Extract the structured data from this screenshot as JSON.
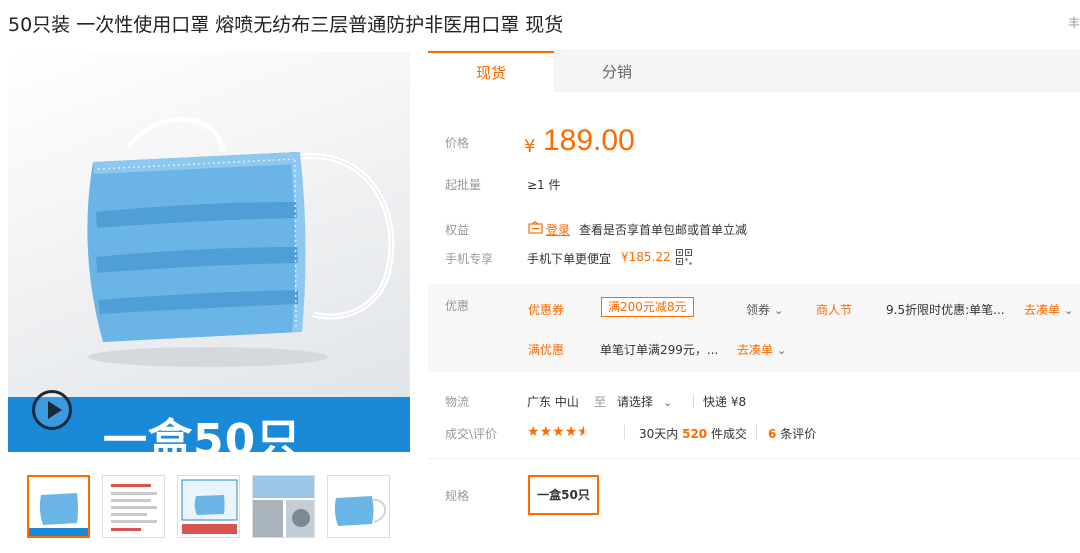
{
  "product": {
    "title": "50只装 一次性使用口罩 熔喷无纺布三层普通防护非医用口罩 现货",
    "title_right": "丰"
  },
  "gallery": {
    "banner_text": "一盒50只",
    "thumbnails": [
      "thumb-1",
      "thumb-2",
      "thumb-3",
      "thumb-4",
      "thumb-5"
    ]
  },
  "tabs": [
    {
      "label": "现货",
      "active": true
    },
    {
      "label": "分销",
      "active": false
    }
  ],
  "price": {
    "label": "价格",
    "symbol": "¥",
    "value": "189.00"
  },
  "moq": {
    "label": "起批量",
    "value": "≥1 件"
  },
  "benefits": {
    "label": "权益",
    "login_link": "登录",
    "text": "查看是否享首单包邮或首单立减"
  },
  "mobile": {
    "label": "手机专享",
    "text": "手机下单更便宜",
    "price": "¥185.22"
  },
  "promo": {
    "label": "优惠",
    "coupon_label": "优惠券",
    "coupon_value": "满200元减8元",
    "claim_label": "领券",
    "festival_label": "商人节",
    "discount_text": "9.5折限时优惠:单笔...",
    "go_label_1": "去凑单",
    "full_label": "满优惠",
    "full_text": "单笔订单满299元，...",
    "go_label_2": "去凑单"
  },
  "logistics": {
    "label": "物流",
    "from": "广东 中山",
    "to_word": "至",
    "select": "请选择",
    "express": "快递 ¥8"
  },
  "reviews": {
    "label": "成交\\评价",
    "rating": 4.5,
    "sold_prefix": "30天内",
    "sold_count": "520",
    "sold_suffix": "件成交",
    "review_count": "6",
    "review_suffix": "条评价"
  },
  "spec": {
    "label": "规格",
    "option": "一盒50只"
  },
  "colors": {
    "accent": "#ff6a00",
    "banner_blue": "#1a8ad8",
    "mask_blue": "#6ab4e6"
  }
}
